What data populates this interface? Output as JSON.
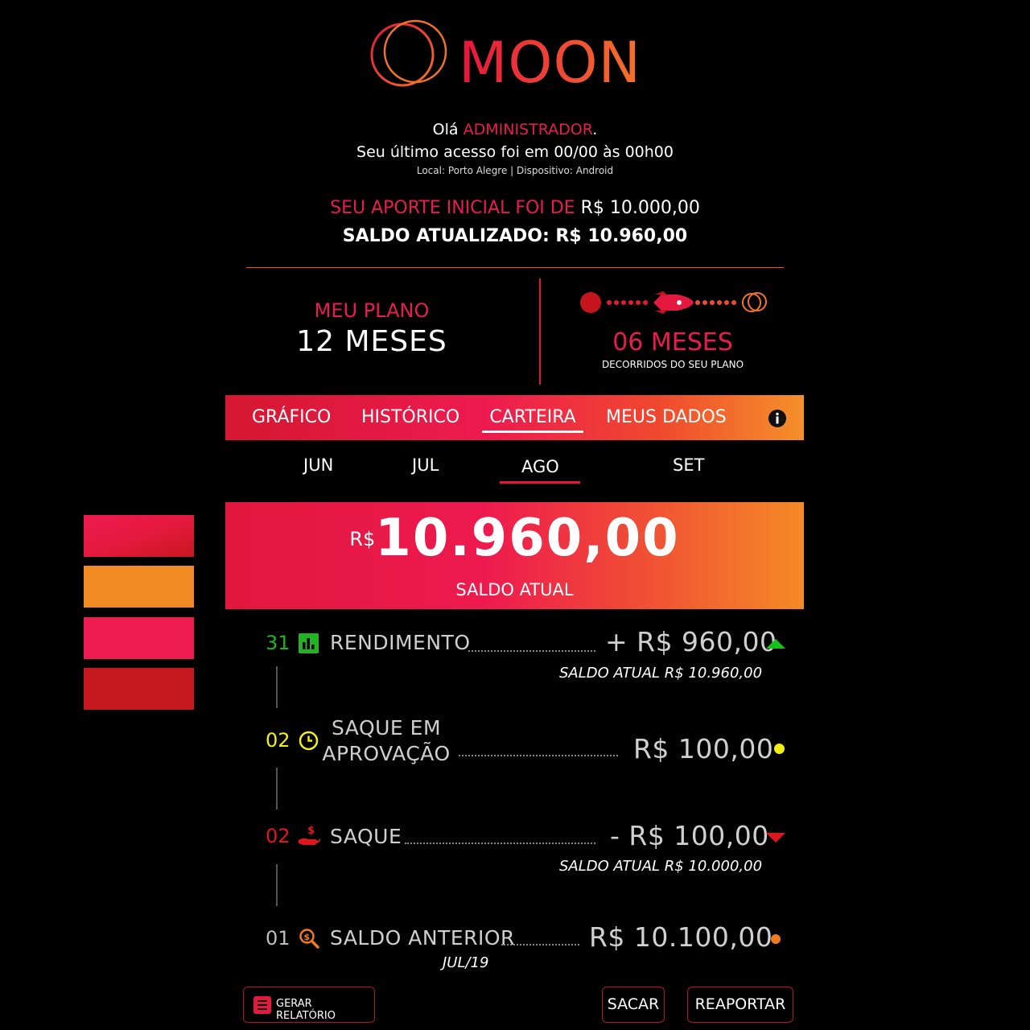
{
  "brand": {
    "name": "MOON",
    "colors": {
      "red": "#e8133f",
      "orange": "#f4732b"
    }
  },
  "greeting": {
    "hello_prefix": "Olá",
    "user": "ADMINISTRADOR",
    "hello_suffix": ".",
    "last_access": "Seu último acesso foi em 00/00 às 00h00",
    "location": "Local: Porto Alegre | Dispositivo: Android"
  },
  "summary": {
    "initial_label": "SEU APORTE INICIAL FOI DE",
    "initial_value": "R$ 10.000,00",
    "balance_line": "SALDO ATUALIZADO: R$ 10.960,00"
  },
  "plan": {
    "label": "MEU PLANO",
    "value": "12 MESES",
    "progress_value": "06 MESES",
    "progress_caption": "DECORRIDOS DO SEU PLANO",
    "progress_fraction": 0.5
  },
  "tabs": [
    {
      "label": "GRÁFICO"
    },
    {
      "label": "HISTÓRICO"
    },
    {
      "label": "CARTEIRA"
    },
    {
      "label": "MEUS DADOS"
    }
  ],
  "active_tab": "CARTEIRA",
  "months": [
    {
      "label": "JUN"
    },
    {
      "label": "JUL"
    },
    {
      "label": "AGO"
    },
    {
      "label": "SET"
    }
  ],
  "active_month": "AGO",
  "balance": {
    "currency": "R$",
    "value": "10.960,00",
    "caption": "SALDO ATUAL"
  },
  "swatches": [
    "#dc1f3c",
    "#f28a24",
    "#ee1a50",
    "#c8181f"
  ],
  "transactions": [
    {
      "day": "31",
      "day_color": "#22b422",
      "icon": "bar-chart-icon",
      "label": "RENDIMENTO",
      "amount": "+ R$ 960,00",
      "sub": "SALDO ATUAL R$ 10.960,00",
      "indicator": "up",
      "indicator_color": "#17c11c"
    },
    {
      "day": "02",
      "day_color": "#f5f10f",
      "icon": "clock-icon",
      "label_line1": "SAQUE EM",
      "label_line2": "APROVAÇÃO",
      "amount": "R$ 100,00",
      "indicator": "dot",
      "indicator_color": "#f3ee14"
    },
    {
      "day": "02",
      "day_color": "#e3151c",
      "icon": "money-hand-icon",
      "label": "SAQUE",
      "amount": "- R$ 100,00",
      "sub": "SALDO ATUAL R$ 10.000,00",
      "indicator": "down",
      "indicator_color": "#e3151c"
    },
    {
      "day": "01",
      "day_color": "#bdbdbd",
      "icon": "search-money-icon",
      "label": "SALDO ANTERIOR",
      "amount": "R$ 10.100,00",
      "sub": "JUL/19",
      "indicator": "dot",
      "indicator_color": "#f07a20"
    }
  ],
  "buttons": {
    "report": "GERAR RELATÓRIO",
    "withdraw": "SACAR",
    "reinvest": "REAPORTAR"
  }
}
